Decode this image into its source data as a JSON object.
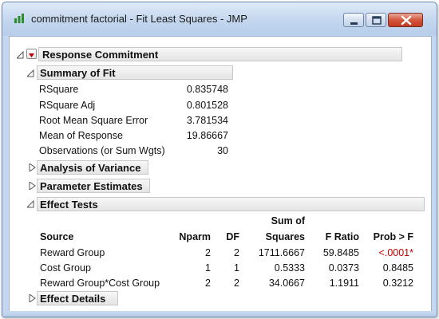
{
  "window": {
    "title": "commitment factorial - Fit Least Squares - JMP"
  },
  "report": {
    "response_header": "Response Commitment",
    "summary_of_fit": {
      "header": "Summary of Fit",
      "rows": [
        {
          "label": "RSquare",
          "value": "0.835748"
        },
        {
          "label": "RSquare Adj",
          "value": "0.801528"
        },
        {
          "label": "Root Mean Square Error",
          "value": "3.781534"
        },
        {
          "label": "Mean of Response",
          "value": "19.86667"
        },
        {
          "label": "Observations (or Sum Wgts)",
          "value": "30"
        }
      ]
    },
    "analysis_of_variance": {
      "header": "Analysis of Variance"
    },
    "parameter_estimates": {
      "header": "Parameter Estimates"
    },
    "effect_tests": {
      "header": "Effect Tests",
      "columns": {
        "source": "Source",
        "nparm": "Nparm",
        "df": "DF",
        "ss_line1": "Sum of",
        "ss_line2": "Squares",
        "f_ratio": "F Ratio",
        "prob": "Prob > F"
      },
      "rows": [
        {
          "source": "Reward Group",
          "nparm": "2",
          "df": "2",
          "ss": "1711.6667",
          "f": "59.8485",
          "p": "<.0001*"
        },
        {
          "source": "Cost Group",
          "nparm": "1",
          "df": "1",
          "ss": "0.5333",
          "f": "0.0373",
          "p": "0.8485"
        },
        {
          "source": "Reward Group*Cost Group",
          "nparm": "2",
          "df": "2",
          "ss": "34.0667",
          "f": "1.1911",
          "p": "0.3212"
        }
      ]
    },
    "effect_details": {
      "header": "Effect Details"
    }
  },
  "colors": {
    "significant_p": "#c00000",
    "accent_red": "#c00000"
  },
  "icons": {
    "app": "jmp-icon",
    "minimize": "minimize-icon",
    "maximize": "maximize-icon",
    "close": "close-icon"
  }
}
